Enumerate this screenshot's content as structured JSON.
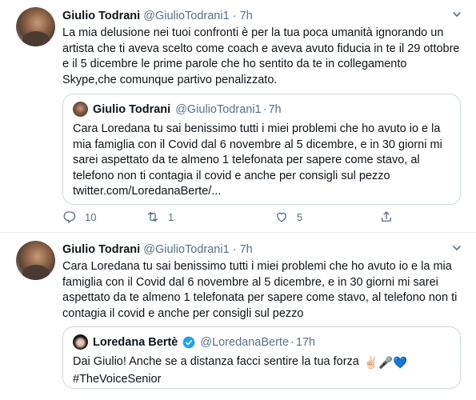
{
  "tweet1": {
    "name": "Giulio Todrani",
    "handle": "@GiulioTodrani1",
    "dot": "·",
    "time": "7h",
    "text": "La mia delusione nei tuoi confronti è per la tua poca umanità ignorando un artista che ti aveva scelto come coach e aveva avuto fiducia in te il 29 ottobre e il 5 dicembre le prime parole che ho sentito da te in collegamento Skype,che comunque partivo penalizzato.",
    "quote": {
      "name": "Giulio Todrani",
      "handle": "@GiulioTodrani1",
      "dot": "·",
      "time": "7h",
      "text": "Cara Loredana tu sai benissimo tutti i miei problemi che ho avuto io e la mia famiglia con il Covid dal 6 novembre al 5 dicembre, e in 30 giorni mi sarei aspettato da te almeno 1 telefonata per sapere come stavo, al telefono non ti contagia il covid e anche per consigli sul pezzo twitter.com/LoredanaBerte/..."
    },
    "actions": {
      "reply_count": "10",
      "retweet_count": "1",
      "like_count": "5"
    }
  },
  "tweet2": {
    "name": "Giulio Todrani",
    "handle": "@GiulioTodrani1",
    "dot": "·",
    "time": "7h",
    "text": "Cara Loredana tu sai benissimo tutti i miei problemi che ho avuto io e la mia famiglia con il Covid dal 6 novembre al 5 dicembre, e in 30 giorni mi sarei aspettato da te almeno 1 telefonata per sapere come stavo, al telefono non ti contagia il covid e anche per consigli sul pezzo",
    "quote": {
      "name": "Loredana Bertè",
      "handle": "@LoredanaBerte",
      "dot": "·",
      "time": "17h",
      "text_line1": "Dai Giulio! Anche se a distanza facci sentire la tua forza",
      "text_line2": "#TheVoiceSenior",
      "emojis": "✌🏻🎤💙"
    }
  },
  "colors": {
    "text": "#0f1419",
    "secondary": "#5b7083",
    "border": "#cfd9de",
    "verified": "#1da1f2"
  },
  "icons": [
    "chevron-down-icon",
    "reply-icon",
    "retweet-icon",
    "like-icon",
    "share-icon",
    "verified-icon"
  ]
}
